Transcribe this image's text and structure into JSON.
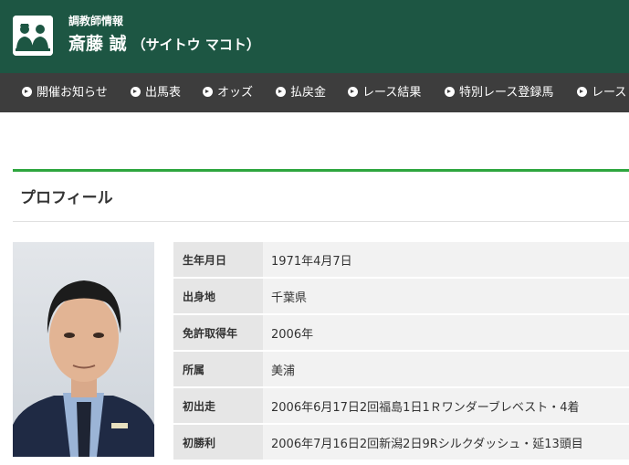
{
  "header": {
    "subtitle": "調教師情報",
    "name": "斎藤 誠",
    "kana": "（サイトウ マコト）",
    "logo_icon": "trainer-logo-icon",
    "bg_color": "#1d5643"
  },
  "nav": {
    "items": [
      {
        "label": "開催お知らせ"
      },
      {
        "label": "出馬表"
      },
      {
        "label": "オッズ"
      },
      {
        "label": "払戻金"
      },
      {
        "label": "レース結果"
      },
      {
        "label": "特別レース登録馬"
      },
      {
        "label": "レース"
      }
    ],
    "bullet_icon": "circle-arrow-right-icon"
  },
  "section": {
    "title": "プロフィール",
    "accent_color": "#2ea63e"
  },
  "profile": {
    "rows": [
      {
        "label": "生年月日",
        "value": "1971年4月7日"
      },
      {
        "label": "出身地",
        "value": "千葉県"
      },
      {
        "label": "免許取得年",
        "value": "2006年"
      },
      {
        "label": "所属",
        "value": "美浦"
      },
      {
        "label": "初出走",
        "value": "2006年6月17日2回福島1日1Ｒワンダーブレベスト・4着"
      },
      {
        "label": "初勝利",
        "value": "2006年7月16日2回新潟2日9Rシルクダッシュ・延13頭目"
      }
    ]
  }
}
